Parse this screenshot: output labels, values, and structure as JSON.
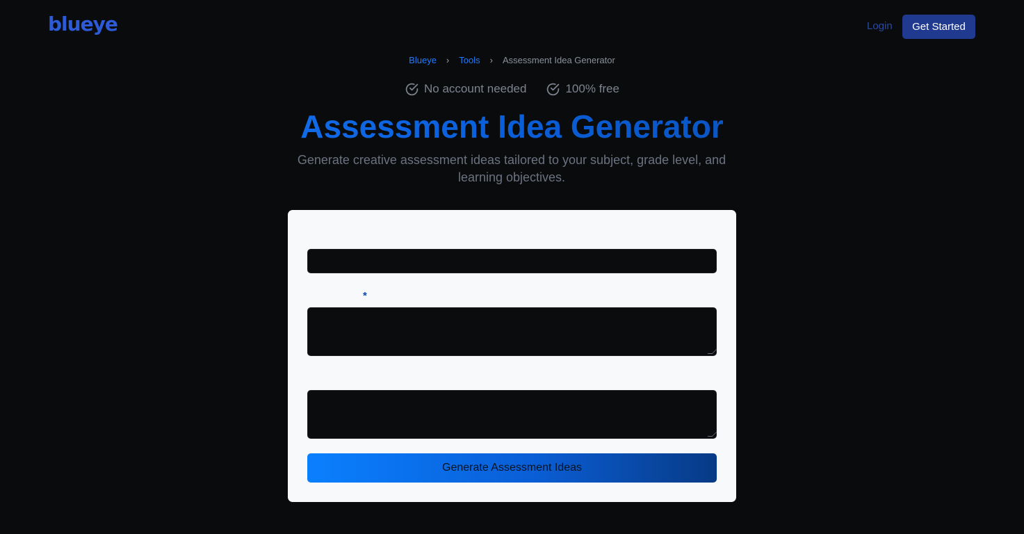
{
  "header": {
    "logo": "blueye",
    "login_label": "Login",
    "cta_label": "Get Started"
  },
  "breadcrumb": {
    "items": [
      "Blueye",
      "Tools",
      "Assessment Idea Generator"
    ]
  },
  "badges": [
    {
      "icon": "check-circle-icon",
      "label": "No account needed"
    },
    {
      "icon": "check-circle-icon",
      "label": "100% free"
    }
  ],
  "hero": {
    "title": "Assessment Idea Generator",
    "subtitle": "Generate creative assessment ideas tailored to your subject, grade level, and learning objectives."
  },
  "form": {
    "required_mark": "*",
    "submit_label": "Generate Assessment Ideas"
  },
  "colors": {
    "accent": "#1f7bff",
    "cta_bg": "#1f3a8f",
    "page_bg": "#0a0b0d",
    "card_bg": "#f8f9fb"
  }
}
